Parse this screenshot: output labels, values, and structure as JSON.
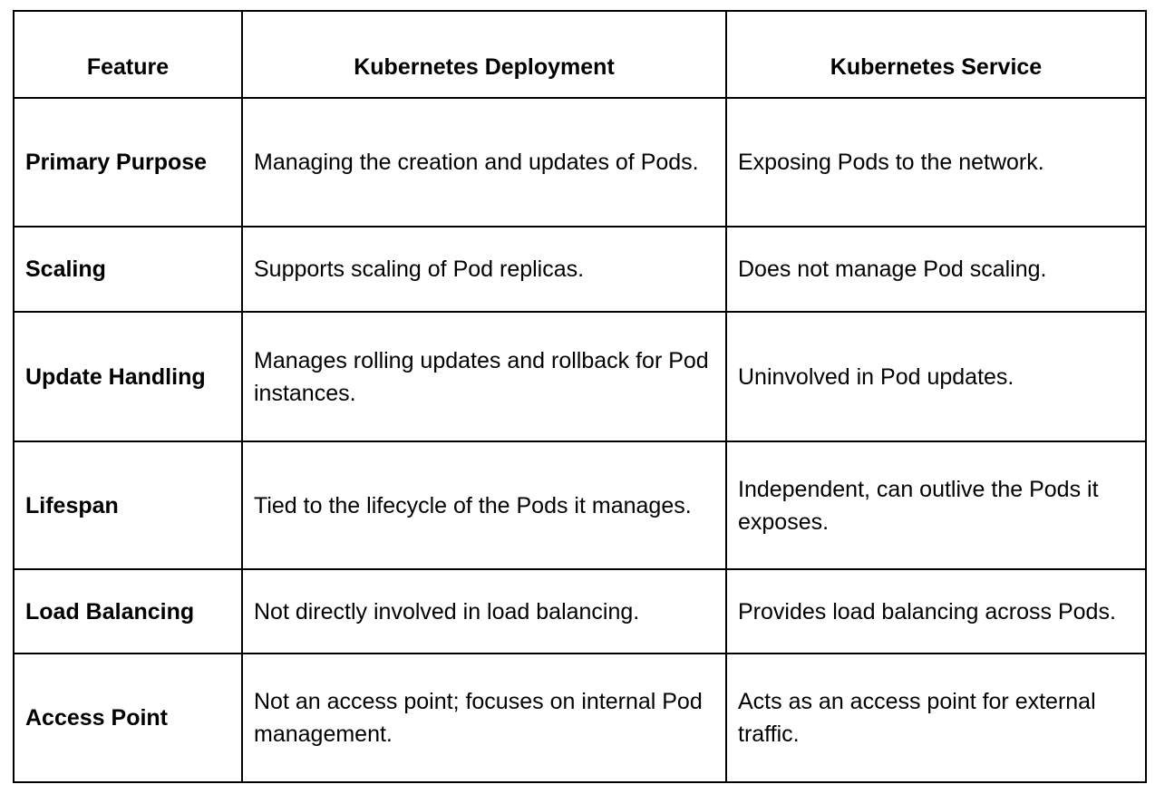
{
  "table": {
    "headers": [
      "Feature",
      "Kubernetes Deployment",
      "Kubernetes Service"
    ],
    "rows": [
      {
        "feature": "Primary Purpose",
        "deployment": "Managing the creation and updates of Pods.",
        "service": "Exposing Pods to the network."
      },
      {
        "feature": "Scaling",
        "deployment": "Supports scaling of Pod replicas.",
        "service": "Does not manage Pod scaling."
      },
      {
        "feature": "Update Handling",
        "deployment": "Manages rolling updates and rollback for Pod instances.",
        "service": "Uninvolved in Pod updates."
      },
      {
        "feature": "Lifespan",
        "deployment": "Tied to the lifecycle of the Pods it manages.",
        "service": "Independent, can outlive the Pods it exposes."
      },
      {
        "feature": "Load Balancing",
        "deployment": "Not directly involved in load balancing.",
        "service": "Provides load balancing across Pods."
      },
      {
        "feature": "Access Point",
        "deployment": "Not an access point; focuses on internal Pod management.",
        "service": "Acts as an access point for external traffic."
      }
    ]
  }
}
